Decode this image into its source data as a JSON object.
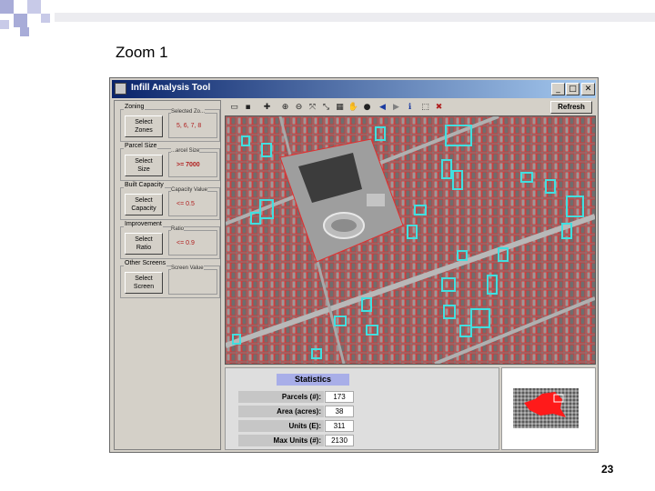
{
  "slide": {
    "title": "Zoom 1",
    "page_number": "23"
  },
  "window": {
    "title": "Infill Analysis Tool",
    "controls": {
      "minimize": "_",
      "maximize": "□",
      "close": "✕"
    }
  },
  "left_panel": {
    "groups": [
      {
        "label": "Zoning",
        "button": "Select\nZones",
        "value_label": "Selected Zo...",
        "value": "5, 6, 7, 8"
      },
      {
        "label": "Parcel Size",
        "button": "Select\nSize",
        "value_label": "...arcel Size",
        "value": ">= 7000"
      },
      {
        "label": "Built Capacity",
        "button": "Select\nCapacity",
        "value_label": "Capacity Value",
        "value": "<= 0.5"
      },
      {
        "label": "Improvement",
        "button": "Select\nRatio",
        "value_label": "Ratio",
        "value": "<= 0.9"
      },
      {
        "label": "Other Screens",
        "button": "Select\nScreen",
        "value_label": "Screen Value",
        "value": ""
      }
    ]
  },
  "toolbar": {
    "refresh_label": "Refresh",
    "tools": [
      "open-folder-icon",
      "save-icon",
      "add-layer-icon",
      "zoom-in-icon",
      "zoom-out-icon",
      "fixed-zoom-in-icon",
      "fixed-zoom-out-icon",
      "full-extent-icon",
      "pan-hand-icon",
      "globe-icon",
      "back-arrow-icon",
      "forward-arrow-icon",
      "info-icon",
      "select-features-icon",
      "clear-selection-icon"
    ]
  },
  "statistics": {
    "title": "Statistics",
    "rows": [
      {
        "label": "Parcels (#):",
        "value": "173"
      },
      {
        "label": "Area (acres):",
        "value": "38"
      },
      {
        "label": "Units (E):",
        "value": "311"
      },
      {
        "label": "Max Units (#):",
        "value": "2130"
      }
    ]
  },
  "colors": {
    "titlebar_start": "#0a246a",
    "titlebar_end": "#a6caf0",
    "window_face": "#d4d0c8",
    "value_text": "#b01e1e",
    "parcel_outline": "#e03030",
    "selected_parcel": "#40e0e0",
    "stats_header": "#a8aee8",
    "deco_square": "#a8acd8"
  }
}
